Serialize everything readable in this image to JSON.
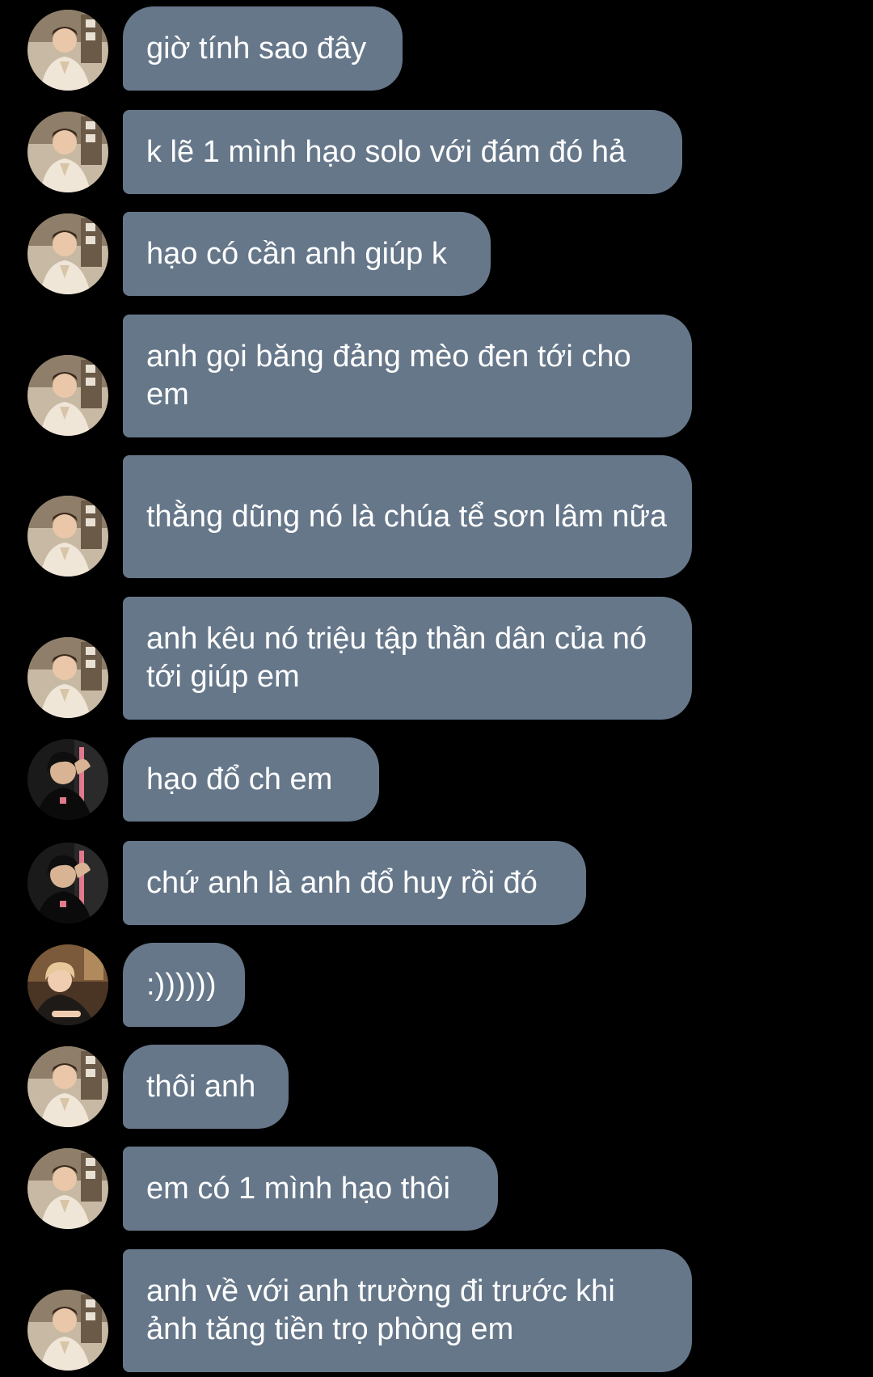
{
  "theme": {
    "background": "#000000",
    "bubble_color": "#66778a",
    "text_color": "#ffffff"
  },
  "messages": [
    {
      "text": "giờ tính sao đây",
      "avatar": "avatar-a"
    },
    {
      "text": "k lẽ 1 mình hạo solo với đám đó hả",
      "avatar": "avatar-a"
    },
    {
      "text": "hạo có cần anh giúp k",
      "avatar": "avatar-a"
    },
    {
      "text": "anh gọi băng đảng mèo đen tới cho em",
      "avatar": "avatar-a"
    },
    {
      "text": "thằng dũng nó là chúa tể sơn lâm nữa",
      "avatar": "avatar-a"
    },
    {
      "text": "anh kêu nó triệu tập thần dân của nó tới giúp em",
      "avatar": "avatar-a"
    },
    {
      "text": "hạo đổ ch em",
      "avatar": "avatar-b"
    },
    {
      "text": "chứ anh là anh đổ huy rồi đó",
      "avatar": "avatar-b"
    },
    {
      "text": ":))))))",
      "avatar": "avatar-c"
    },
    {
      "text": "thôi anh",
      "avatar": "avatar-a"
    },
    {
      "text": "em có 1 mình hạo thôi",
      "avatar": "avatar-a"
    },
    {
      "text": "anh về với anh trường đi trước khi ảnh tăng tiền trọ phòng em",
      "avatar": "avatar-a"
    }
  ]
}
